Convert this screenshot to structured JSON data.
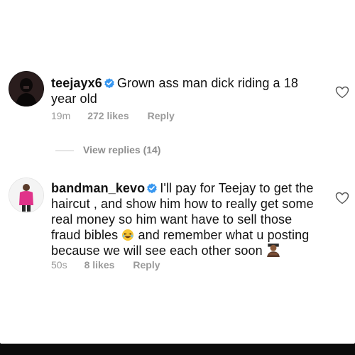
{
  "comments": [
    {
      "username": "teejayx6",
      "verified": true,
      "line1": "Grown ass man dick riding a 18",
      "line2": "year old",
      "time": "19m",
      "likes": "272 likes",
      "reply": "Reply",
      "view_replies": "View replies (14)"
    },
    {
      "username": "bandman_kevo",
      "verified": true,
      "line1": "I'll pay for Teejay to get the",
      "line2": "haircut , and show him how to really get some",
      "line3": "real money so him want have to sell those",
      "line4a": "fraud bibles",
      "line4b": "and remember what u posting",
      "line5": "because we will see each other soon",
      "time": "50s",
      "likes": "8 likes",
      "reply": "Reply"
    }
  ],
  "icons": {
    "verified": "verified-badge-icon",
    "heart": "heart-outline-icon",
    "laugh": "laughing-emoji-icon",
    "person": "person-emoji-icon"
  },
  "colors": {
    "verified": "#3897f0",
    "meta": "#9a9a9a",
    "text": "#111111"
  }
}
